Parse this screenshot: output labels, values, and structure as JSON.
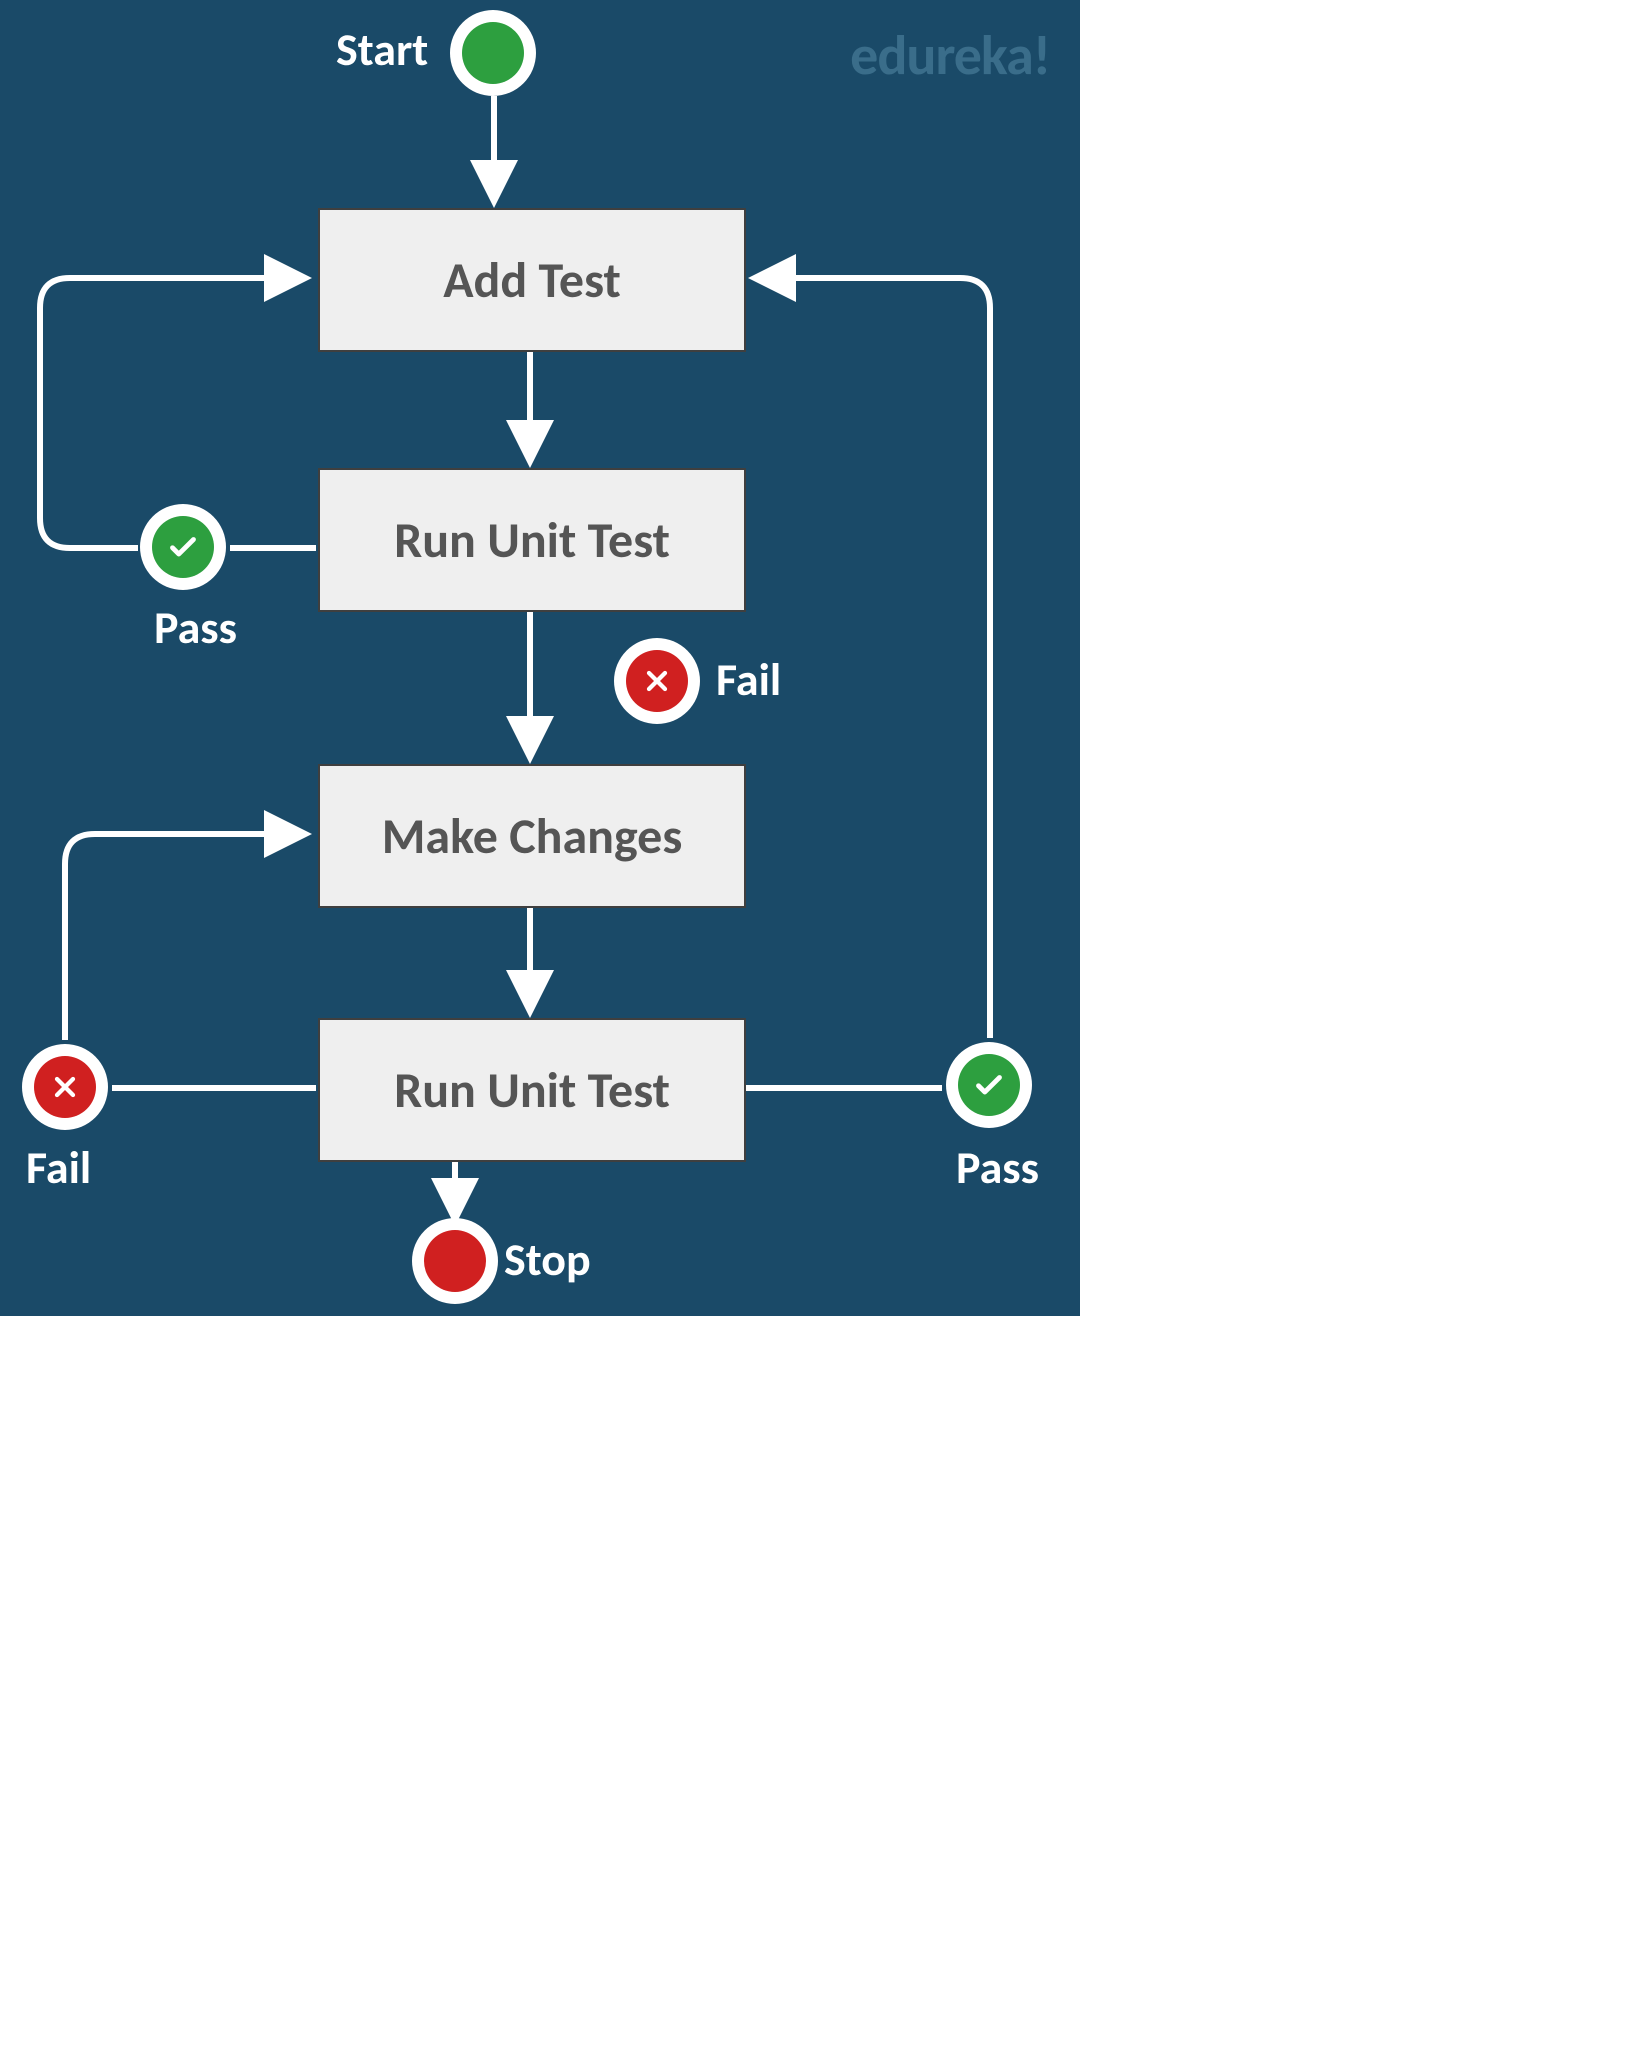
{
  "brand": "edureka!",
  "start_label": "Start",
  "stop_label": "Stop",
  "boxes": {
    "add_test": "Add Test",
    "run_unit_test_1": "Run Unit Test",
    "make_changes": "Make Changes",
    "run_unit_test_2": "Run Unit Test"
  },
  "labels": {
    "pass1": "Pass",
    "fail1": "Fail",
    "fail2": "Fail",
    "pass2": "Pass"
  },
  "chart_data": {
    "type": "flowchart",
    "nodes": [
      {
        "id": "start",
        "type": "start",
        "label": "Start"
      },
      {
        "id": "add_test",
        "type": "process",
        "label": "Add Test"
      },
      {
        "id": "run1",
        "type": "process",
        "label": "Run Unit Test"
      },
      {
        "id": "make_changes",
        "type": "process",
        "label": "Make Changes"
      },
      {
        "id": "run2",
        "type": "process",
        "label": "Run Unit Test"
      },
      {
        "id": "stop",
        "type": "end",
        "label": "Stop"
      }
    ],
    "edges": [
      {
        "from": "start",
        "to": "add_test"
      },
      {
        "from": "add_test",
        "to": "run1"
      },
      {
        "from": "run1",
        "to": "add_test",
        "label": "Pass"
      },
      {
        "from": "run1",
        "to": "make_changes",
        "label": "Fail"
      },
      {
        "from": "make_changes",
        "to": "run2"
      },
      {
        "from": "run2",
        "to": "make_changes",
        "label": "Fail"
      },
      {
        "from": "run2",
        "to": "add_test",
        "label": "Pass"
      },
      {
        "from": "run2",
        "to": "stop"
      }
    ]
  }
}
